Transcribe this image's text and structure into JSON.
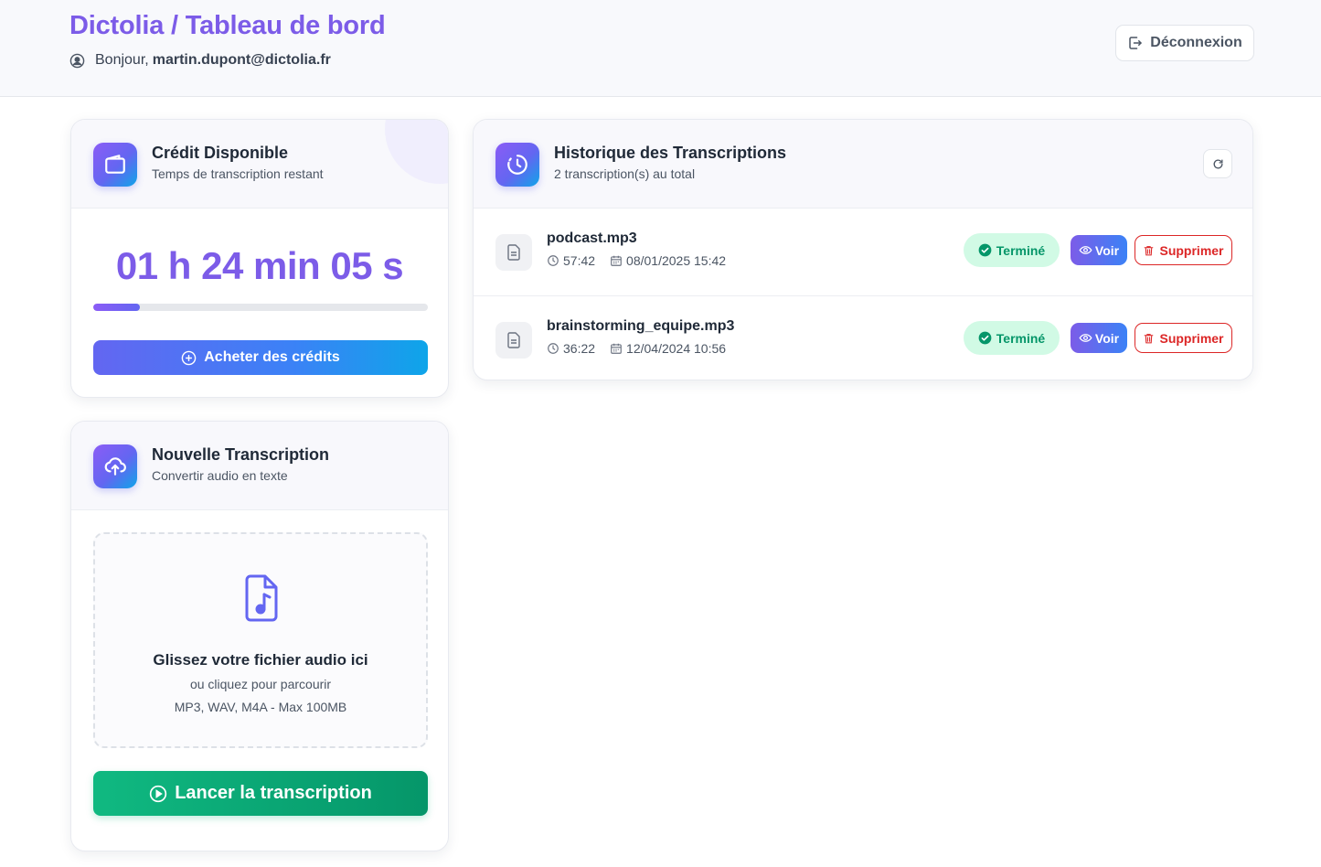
{
  "header": {
    "title": "Dictolia / Tableau de bord",
    "greeting_prefix": "Bonjour,",
    "user_email": "martin.dupont@dictolia.fr",
    "logout_label": "Déconnexion"
  },
  "credit": {
    "title": "Crédit Disponible",
    "subtitle": "Temps de transcription restant",
    "remaining": "01 h 24 min 05 s",
    "progress_fraction": 0.14,
    "buy_label": "Acheter des crédits"
  },
  "upload": {
    "title": "Nouvelle Transcription",
    "subtitle": "Convertir audio en texte",
    "drop_title": "Glissez votre fichier audio ici",
    "drop_sub": "ou cliquez pour parcourir",
    "drop_formats": "MP3, WAV, M4A - Max 100MB",
    "start_label": "Lancer la transcription"
  },
  "history": {
    "title": "Historique des Transcriptions",
    "subtitle": "2 transcription(s) au total",
    "status_label": "Terminé",
    "view_label": "Voir",
    "delete_label": "Supprimer",
    "items": [
      {
        "file": "podcast.mp3",
        "duration": "57:42",
        "date": "08/01/2025 15:42"
      },
      {
        "file": "brainstorming_equipe.mp3",
        "duration": "36:22",
        "date": "12/04/2024 10:56"
      }
    ]
  },
  "colors": {
    "brand": "#7c5ce8",
    "success": "#10b981",
    "danger": "#dc2626"
  }
}
